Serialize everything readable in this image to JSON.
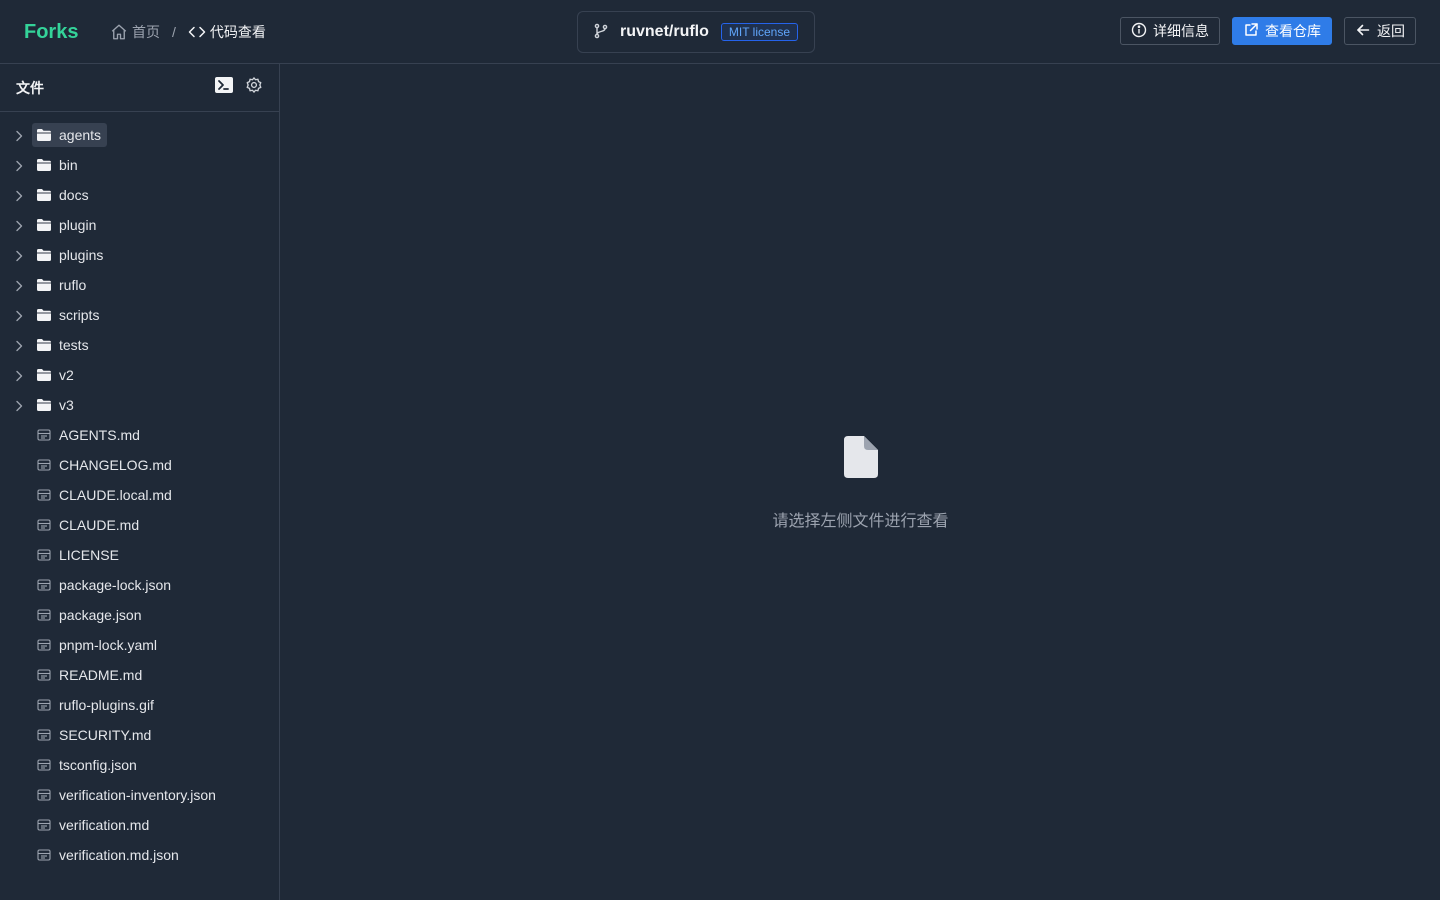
{
  "app": {
    "logo": "Forks"
  },
  "breadcrumb": {
    "home": "首页",
    "separator": "/",
    "current": "代码查看"
  },
  "repo": {
    "name": "ruvnet/ruflo",
    "license": "MIT license"
  },
  "actions": {
    "details": "详细信息",
    "view_repo": "查看仓库",
    "back": "返回"
  },
  "sidebar": {
    "title": "文件",
    "folders": [
      "agents",
      "bin",
      "docs",
      "plugin",
      "plugins",
      "ruflo",
      "scripts",
      "tests",
      "v2",
      "v3"
    ],
    "files": [
      "AGENTS.md",
      "CHANGELOG.md",
      "CLAUDE.local.md",
      "CLAUDE.md",
      "LICENSE",
      "package-lock.json",
      "package.json",
      "pnpm-lock.yaml",
      "README.md",
      "ruflo-plugins.gif",
      "SECURITY.md",
      "tsconfig.json",
      "verification-inventory.json",
      "verification.md",
      "verification.md.json"
    ],
    "selected": "agents"
  },
  "empty_state": {
    "message": "请选择左侧文件进行查看",
    "icon": "file-icon"
  },
  "colors": {
    "accent": "#34d399",
    "primary": "#2f7ce8",
    "background": "#1f2937",
    "border": "#374151"
  }
}
